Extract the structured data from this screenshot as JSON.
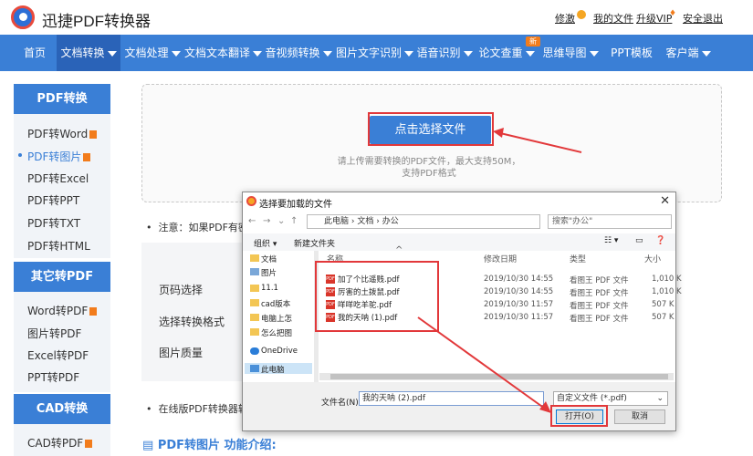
{
  "header": {
    "logo_text": "迅捷PDF转换器",
    "links": [
      "修激",
      "我的文件",
      "升级VIP",
      "安全退出"
    ]
  },
  "nav": {
    "items": [
      {
        "label": "首页",
        "dropdown": false
      },
      {
        "label": "文档转换",
        "dropdown": true,
        "active": true
      },
      {
        "label": "文档处理",
        "dropdown": true
      },
      {
        "label": "文档文本翻译",
        "dropdown": true
      },
      {
        "label": "音视频转换",
        "dropdown": true
      },
      {
        "label": "图片文字识别",
        "dropdown": true
      },
      {
        "label": "语音识别",
        "dropdown": true
      },
      {
        "label": "论文查重",
        "dropdown": true
      },
      {
        "label": "思维导图",
        "dropdown": true
      },
      {
        "label": "PPT模板",
        "dropdown": false
      },
      {
        "label": "客户端",
        "dropdown": true
      }
    ],
    "new_badge": "新"
  },
  "sidebar": {
    "sections": [
      {
        "title": "PDF转换",
        "items": [
          "PDF转Word",
          "PDF转图片",
          "PDF转Excel",
          "PDF转PPT",
          "PDF转TXT",
          "PDF转HTML"
        ]
      },
      {
        "title": "其它转PDF",
        "items": [
          "Word转PDF",
          "图片转PDF",
          "Excel转PDF",
          "PPT转PDF"
        ]
      },
      {
        "title": "CAD转换",
        "items": [
          "CAD转PDF"
        ]
      }
    ]
  },
  "main": {
    "upload_button": "点击选择文件",
    "hint_line1": "请上传需要转换的PDF文件，最大支持50M，",
    "hint_line2": "支持PDF格式",
    "note1": "注意：如果PDF有密",
    "setting_labels": [
      "页码选择",
      "选择转换格式",
      "图片质量"
    ],
    "note2": "在线版PDF转换器转",
    "intro": "PDF转图片 功能介绍:"
  },
  "dialog": {
    "title": "选择要加载的文件",
    "breadcrumb": [
      "此电脑",
      "文档",
      "办公"
    ],
    "search_placeholder": "搜索\"办公\"",
    "toolbar": {
      "organize": "组织",
      "new_folder": "新建文件夹"
    },
    "tree": [
      "文档",
      "图片",
      "11.1",
      "cad版本",
      "电脑上怎",
      "怎么把图",
      "OneDrive",
      "此电脑"
    ],
    "columns": {
      "name": "名称",
      "date": "修改日期",
      "type": "类型",
      "size": "大小"
    },
    "files": [
      {
        "name": "加了个比遥贱.pdf",
        "date": "2019/10/30 14:55",
        "type": "看图王 PDF 文件",
        "size": "1,010 K"
      },
      {
        "name": "厉害的土拨鼠.pdf",
        "date": "2019/10/30 14:55",
        "type": "看图王 PDF 文件",
        "size": "1,010 K"
      },
      {
        "name": "咩咩吃羊驼.pdf",
        "date": "2019/10/30 11:57",
        "type": "看图王 PDF 文件",
        "size": "507 K"
      },
      {
        "name": "我的天呐 (1).pdf",
        "date": "2019/10/30 11:57",
        "type": "看图王 PDF 文件",
        "size": "507 K"
      }
    ],
    "filename_label": "文件名(N):",
    "filename_value": "我的天呐 (2).pdf",
    "filetype_value": "自定义文件 (*.pdf)",
    "open_button": "打开(O)",
    "cancel_button": "取消"
  },
  "colors": {
    "brand": "#3a7fd6",
    "nav_active": "#2a63b8",
    "highlight": "#e2383a",
    "accent": "#f27c1c"
  }
}
